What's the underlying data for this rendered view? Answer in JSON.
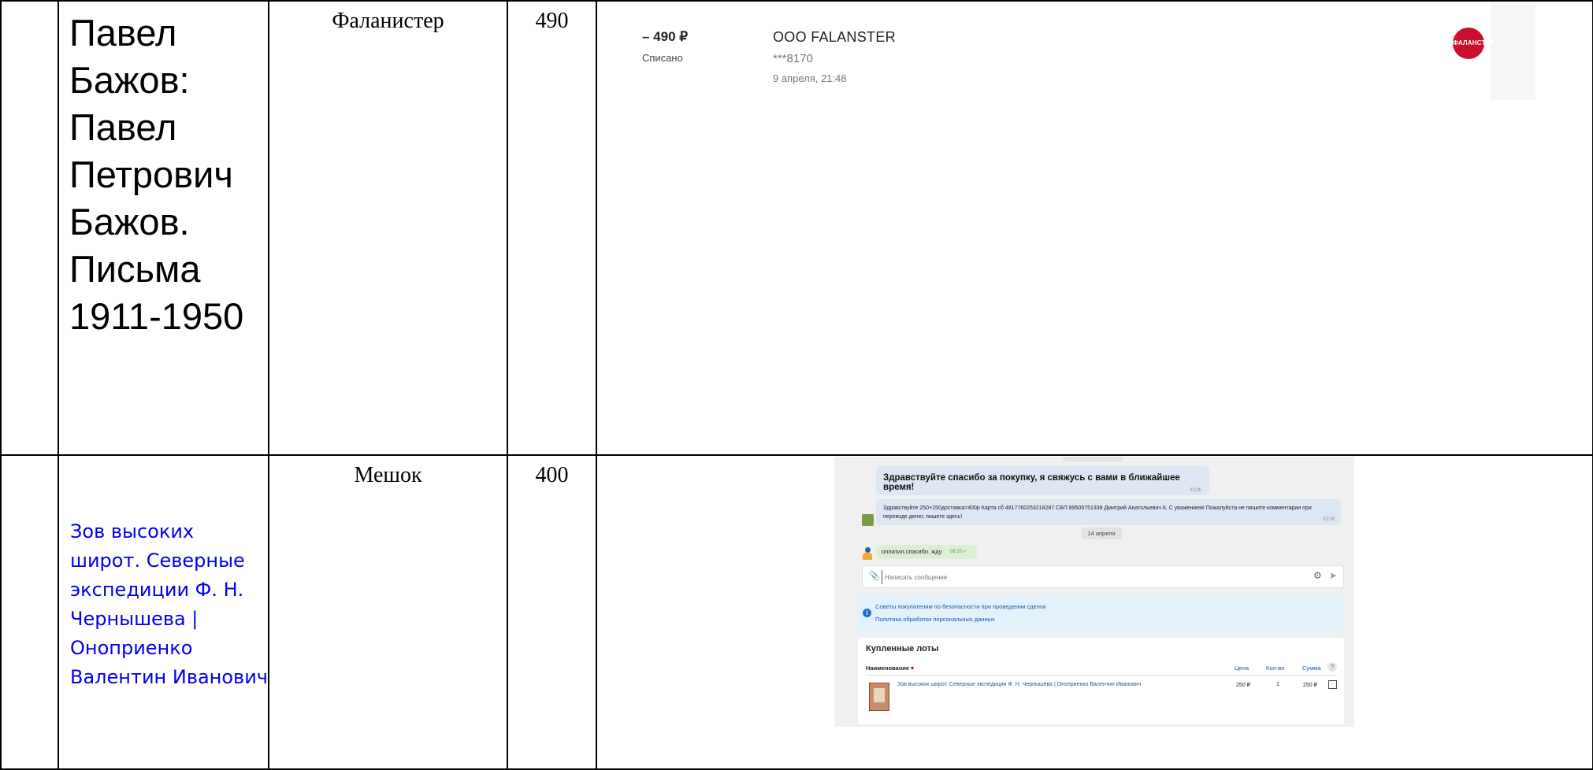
{
  "rows": [
    {
      "title": "Павел Бажов: Павел Петрович Бажов. Письма 1911-1950",
      "seller": "Фаланистер",
      "price": "490",
      "receipt": {
        "amount": "– 490 ₽",
        "status": "Списано",
        "merchant": "ООО FALANSTER",
        "card": "***8170",
        "date": "9 апреля, 21:48",
        "logo_text": "ФАЛАНСТЕР",
        "logo_color": "#c8102e"
      }
    },
    {
      "title": "Зов высоких широт. Северные экспедиции Ф. Н. Чернышева | Оноприенко Валентин Иванович",
      "seller": "Мешок",
      "price": "400",
      "chat": {
        "message1": "Здравствуйте спасибо за покупку, я свяжусь с вами в ближайшее время!",
        "message1_time": "21:20",
        "message2": "Здравствуйте 250+150доставка=400р Карта сб 4817760253218287 СБП 89505751338 Дмитрий Анатольевич К. С уважением! Пожалуйста не пишите комментарии при переводе денег, пишете здесь!",
        "message2_time": "22:28",
        "date_separator": "14 апреля",
        "message3": "оплатил.спасибо. жду",
        "message3_time": "08:10 ✓",
        "input_placeholder": "Написать сообщение",
        "info_link1": "Советы покупателям по безопасности при проведении сделок",
        "info_link2": "Политика обработки персональных данных",
        "lots_heading": "Купленные лоты",
        "lots_headers": {
          "name": "Наименование",
          "price": "Цена",
          "qty": "Кол-во",
          "sum": "Сумма"
        },
        "lot": {
          "name": "Зов высоких широт. Северные экспедиции Ф. Н. Чернышева | Оноприенко Валентин Иванович",
          "price": "250 ₽",
          "qty": "1",
          "sum": "250 ₽"
        }
      }
    }
  ]
}
